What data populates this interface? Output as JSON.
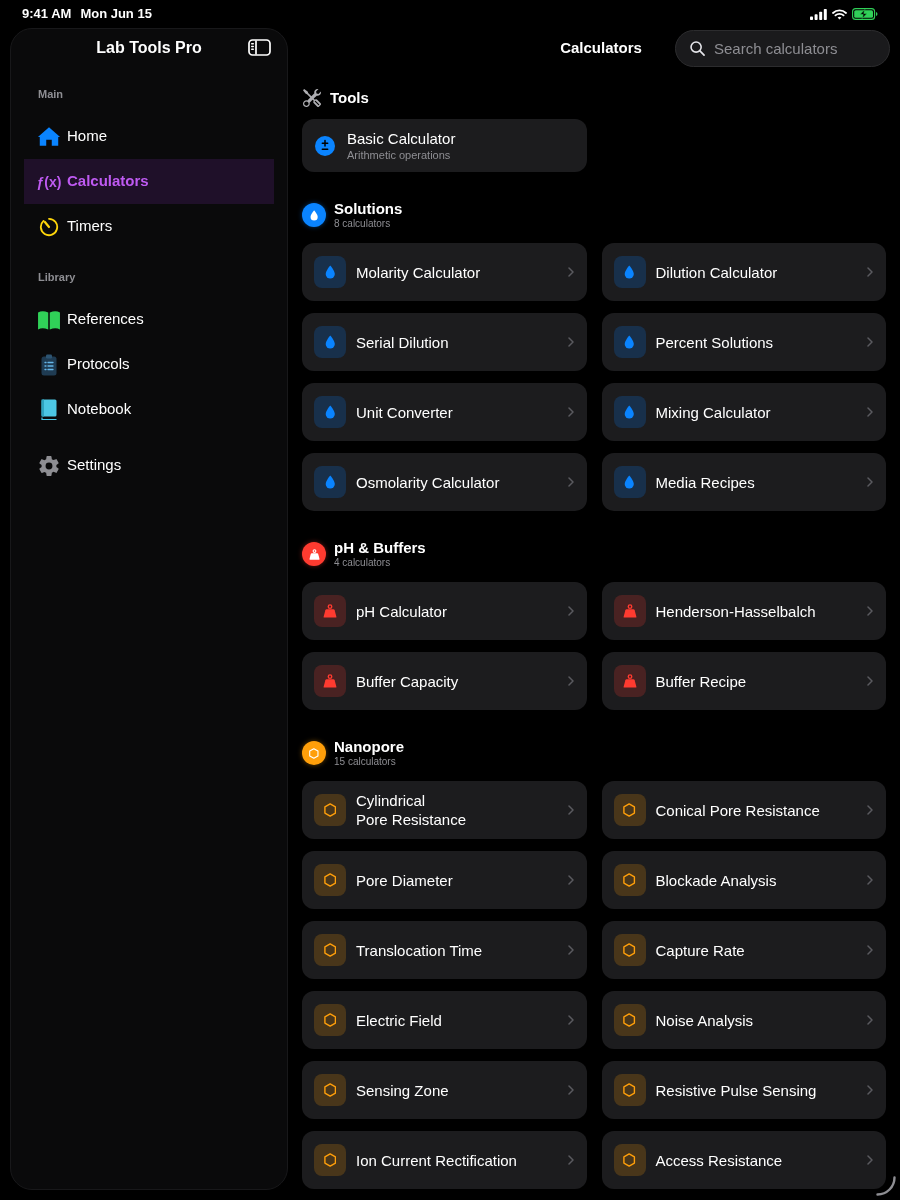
{
  "status_bar": {
    "time": "9:41 AM",
    "date": "Mon Jun 15",
    "battery_charging": true
  },
  "sidebar": {
    "title": "Lab Tools Pro",
    "sections": [
      {
        "label": "Main",
        "items": [
          {
            "kind": "home",
            "label": "Home",
            "selected": false
          },
          {
            "kind": "function",
            "glyph": "ƒ(x)",
            "label": "Calculators",
            "selected": true
          },
          {
            "kind": "timer",
            "label": "Timers",
            "selected": false
          }
        ]
      },
      {
        "label": "Library",
        "items": [
          {
            "kind": "references",
            "label": "References",
            "selected": false
          },
          {
            "kind": "protocols",
            "label": "Protocols",
            "selected": false
          },
          {
            "kind": "notebook",
            "label": "Notebook",
            "selected": false
          }
        ]
      },
      {
        "items": [
          {
            "kind": "settings",
            "label": "Settings",
            "selected": false
          }
        ]
      }
    ]
  },
  "header": {
    "title": "Calculators",
    "search": {
      "placeholder": "Search calculators"
    }
  },
  "sections": [
    {
      "kind": "tools",
      "title": "Tools",
      "cards": [
        {
          "title": "Basic Calculator",
          "subtitle": "Arithmetic operations"
        }
      ]
    },
    {
      "kind": "drop",
      "title": "Solutions",
      "count": "8 calculators",
      "color": "#0a84ff",
      "cards": [
        {
          "title": "Molarity Calculator"
        },
        {
          "title": "Dilution Calculator"
        },
        {
          "title": "Serial Dilution"
        },
        {
          "title": "Percent Solutions"
        },
        {
          "title": "Unit Converter"
        },
        {
          "title": "Mixing Calculator"
        },
        {
          "title": "Osmolarity Calculator"
        },
        {
          "title": "Media Recipes"
        }
      ]
    },
    {
      "kind": "weight",
      "title": "pH & Buffers",
      "count": "4 calculators",
      "color": "#ff3b30",
      "cards": [
        {
          "title": "pH Calculator"
        },
        {
          "title": "Henderson-Hasselbalch"
        },
        {
          "title": "Buffer Capacity"
        },
        {
          "title": "Buffer Recipe"
        }
      ]
    },
    {
      "kind": "hexagon",
      "title": "Nanopore",
      "count": "15 calculators",
      "color": "#ff9f0a",
      "cards": [
        {
          "title": "Cylindrical\nPore Resistance"
        },
        {
          "title": "Conical Pore Resistance"
        },
        {
          "title": "Pore Diameter"
        },
        {
          "title": "Blockade Analysis"
        },
        {
          "title": "Translocation Time"
        },
        {
          "title": "Capture Rate"
        },
        {
          "title": "Electric Field"
        },
        {
          "title": "Noise Analysis"
        },
        {
          "title": "Sensing Zone"
        },
        {
          "title": "Resistive Pulse Sensing"
        },
        {
          "title": "Ion Current Rectification"
        },
        {
          "title": "Access Resistance"
        }
      ]
    }
  ]
}
